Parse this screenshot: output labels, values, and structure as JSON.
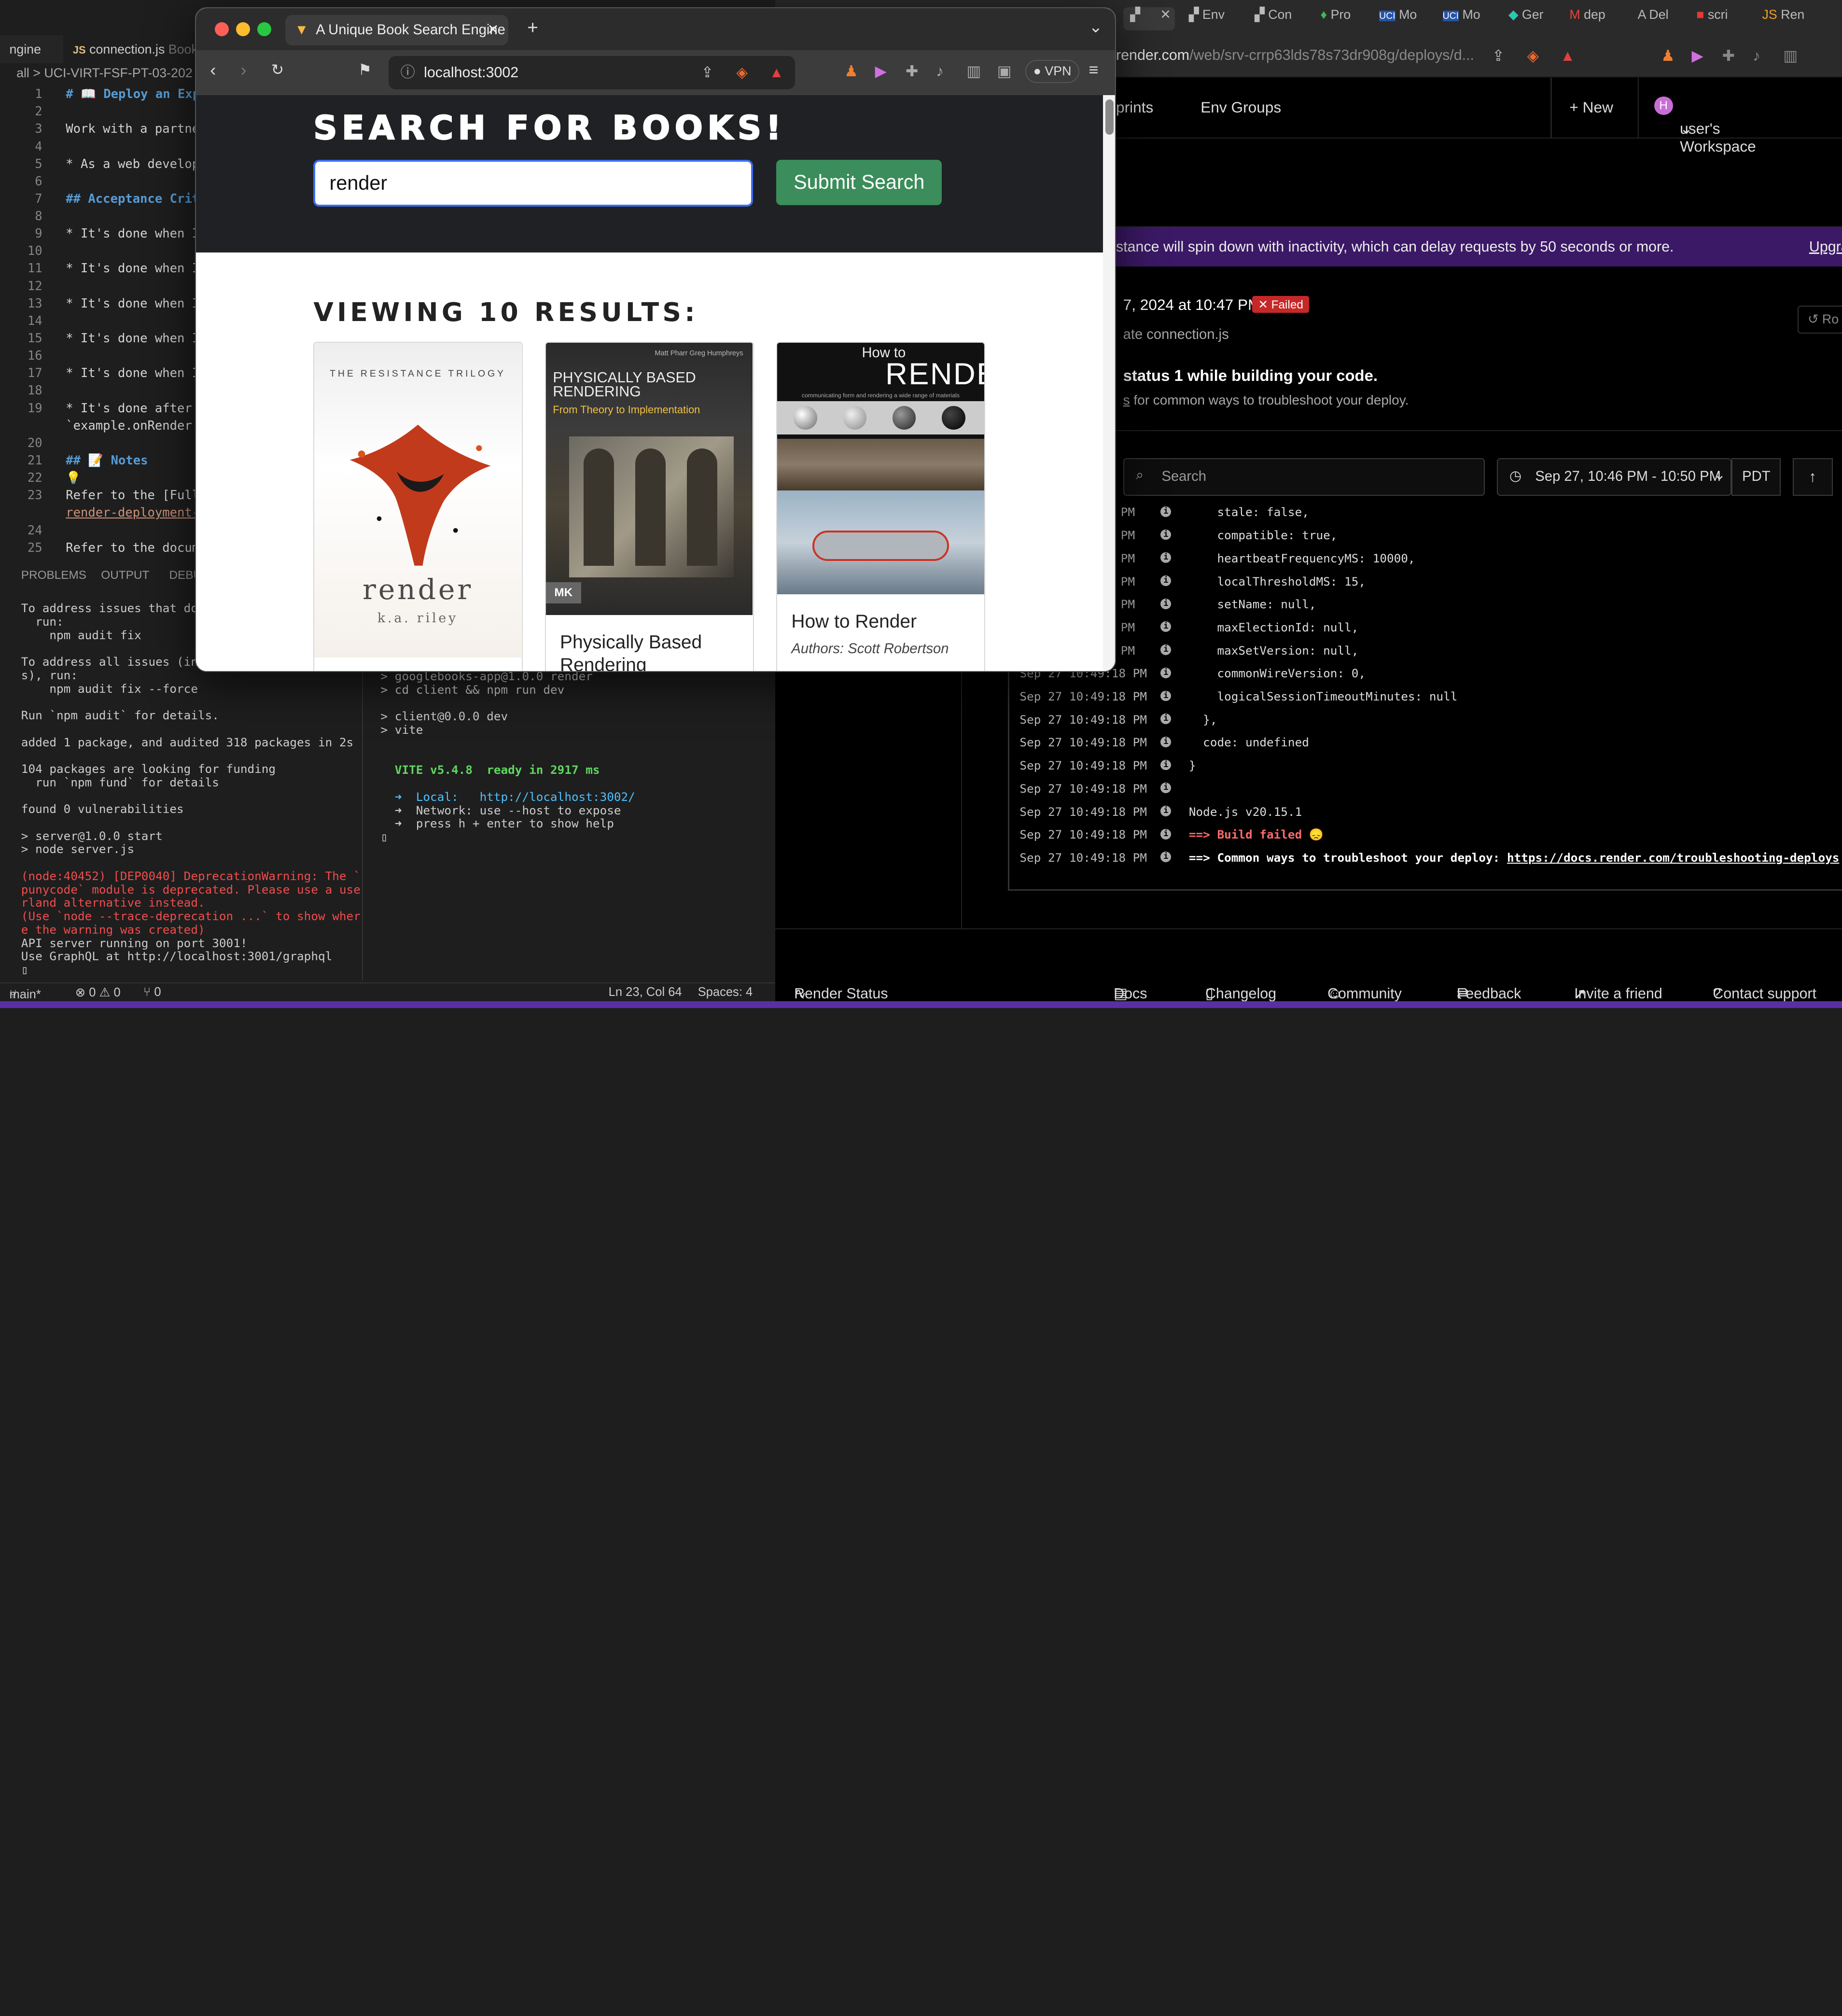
{
  "vscode": {
    "tab_left": "ngine",
    "tab_file": "connection.js",
    "tab_file_suffix": "Book",
    "breadcrumb": "all > UCI-VIRT-FSF-PT-03-202",
    "lines": [
      {
        "n": "1",
        "t": "# 📖 Deploy an Expr",
        "c": "h"
      },
      {
        "n": "2",
        "t": "",
        "c": ""
      },
      {
        "n": "3",
        "t": "Work with a partner",
        "c": ""
      },
      {
        "n": "4",
        "t": "",
        "c": ""
      },
      {
        "n": "5",
        "t": "* As a web develope",
        "c": ""
      },
      {
        "n": "6",
        "t": "",
        "c": ""
      },
      {
        "n": "7",
        "t": "## Acceptance Crite",
        "c": "h"
      },
      {
        "n": "8",
        "t": "",
        "c": ""
      },
      {
        "n": "9",
        "t": "* It's done when I",
        "c": ""
      },
      {
        "n": "10",
        "t": "",
        "c": ""
      },
      {
        "n": "11",
        "t": "* It's done when I",
        "c": ""
      },
      {
        "n": "12",
        "t": "",
        "c": ""
      },
      {
        "n": "13",
        "t": "* It's done when I",
        "c": ""
      },
      {
        "n": "14",
        "t": "",
        "c": ""
      },
      {
        "n": "15",
        "t": "* It's done when I",
        "c": ""
      },
      {
        "n": "16",
        "t": "",
        "c": ""
      },
      {
        "n": "17",
        "t": "* It's done when I",
        "c": ""
      },
      {
        "n": "18",
        "t": "",
        "c": ""
      },
      {
        "n": "19",
        "t": "* It's done after I",
        "c": ""
      },
      {
        "n": "",
        "t": "`example.onRender.c",
        "c": ""
      },
      {
        "n": "20",
        "t": "",
        "c": ""
      },
      {
        "n": "21",
        "t": "## 📝 Notes",
        "c": "h"
      },
      {
        "n": "22",
        "t": "💡",
        "c": ""
      },
      {
        "n": "23",
        "t": "Refer to the [Full-",
        "c": ""
      },
      {
        "n": "",
        "t": "render-deployment-c",
        "c": "u"
      },
      {
        "n": "24",
        "t": "",
        "c": ""
      },
      {
        "n": "25",
        "t": "Refer to the docume",
        "c": ""
      }
    ],
    "panel_tabs": [
      "PROBLEMS",
      "OUTPUT",
      "DEBU"
    ],
    "terminal_left": [
      {
        "t": "To address issues that do",
        "c": ""
      },
      {
        "t": "  run:",
        "c": ""
      },
      {
        "t": "    npm audit fix",
        "c": ""
      },
      {
        "t": "",
        "c": ""
      },
      {
        "t": "To address all issues (inc",
        "c": ""
      },
      {
        "t": "s), run:",
        "c": ""
      },
      {
        "t": "    npm audit fix --force",
        "c": ""
      },
      {
        "t": "",
        "c": ""
      },
      {
        "t": "Run `npm audit` for details.",
        "c": ""
      },
      {
        "t": "",
        "c": ""
      },
      {
        "t": "added 1 package, and audited 318 packages in 2s",
        "c": ""
      },
      {
        "t": "",
        "c": ""
      },
      {
        "t": "104 packages are looking for funding",
        "c": ""
      },
      {
        "t": "  run `npm fund` for details",
        "c": ""
      },
      {
        "t": "",
        "c": ""
      },
      {
        "t": "found 0 vulnerabilities",
        "c": ""
      },
      {
        "t": "",
        "c": ""
      },
      {
        "t": "> server@1.0.0 start",
        "c": ""
      },
      {
        "t": "> node server.js",
        "c": ""
      },
      {
        "t": "",
        "c": ""
      },
      {
        "t": "(node:40452) [DEP0040] DeprecationWarning: The `",
        "c": "err"
      },
      {
        "t": "punycode` module is deprecated. Please use a use",
        "c": "err"
      },
      {
        "t": "rland alternative instead.",
        "c": "err"
      },
      {
        "t": "(Use `node --trace-deprecation ...` to show wher",
        "c": "err"
      },
      {
        "t": "e the warning was created)",
        "c": "err"
      },
      {
        "t": "API server running on port 3001!",
        "c": ""
      },
      {
        "t": "Use GraphQL at http://localhost:3001/graphql",
        "c": ""
      },
      {
        "t": "▯",
        "c": ""
      }
    ],
    "terminal_right": [
      {
        "t": "> googlebooks-app@1.0.0 render",
        "c": ""
      },
      {
        "t": "> cd client && npm run dev",
        "c": ""
      },
      {
        "t": "",
        "c": ""
      },
      {
        "t": "> client@0.0.0 dev",
        "c": ""
      },
      {
        "t": "> vite",
        "c": ""
      },
      {
        "t": "",
        "c": ""
      },
      {
        "t": "",
        "c": ""
      },
      {
        "t": "  VITE v5.4.8  ready in 2917 ms",
        "c": "vite"
      },
      {
        "t": "",
        "c": ""
      },
      {
        "t": "  ➜  Local:   http://localhost:3002/",
        "c": "url"
      },
      {
        "t": "  ➜  Network: use --host to expose",
        "c": ""
      },
      {
        "t": "  ➜  press h + enter to show help",
        "c": ""
      },
      {
        "t": "▯",
        "c": ""
      }
    ],
    "status": {
      "branch": "main*",
      "errors": "⊗ 0 ⚠ 0",
      "ports": "⑂ 0",
      "position": "Ln 23, Col 64",
      "spaces": "Spaces: 4"
    }
  },
  "render": {
    "tabs": [
      "",
      "Env",
      "Con",
      "Pro",
      "Mo",
      "Mo",
      "Ger",
      "dep",
      "Del",
      "scri",
      "Ren"
    ],
    "url_host": "render.com",
    "url_path": "/web/srv-crrp63lds78s73dr908g/deploys/d...",
    "nav": {
      "blueprints": "prints",
      "env_groups": "Env Groups",
      "new": "+ New",
      "workspace": "user's Workspace",
      "workspace_initial": "H"
    },
    "banner": "stance will spin down with inactivity, which can delay requests by 50 seconds or more.",
    "banner_link": "Upgra",
    "deploy_date": "7, 2024 at 10:47 PM",
    "deploy_status": "✕ Failed",
    "deploy_commit": "ate connection.js",
    "rollback": "↺ Ro",
    "error_title": "status 1 while building your code.",
    "error_link": "s",
    "error_sub": " for common ways to troubleshoot your deploy.",
    "search_placeholder": "Search",
    "range": "Sep 27, 10:46 PM - 10:50 PM",
    "tz": "PDT",
    "up": "↑",
    "logs": [
      {
        "ts": "8 PM",
        "msg": "    stale: false,",
        "c": ""
      },
      {
        "ts": "8 PM",
        "msg": "    compatible: true,",
        "c": ""
      },
      {
        "ts": "8 PM",
        "msg": "    heartbeatFrequencyMS: 10000,",
        "c": ""
      },
      {
        "ts": "8 PM",
        "msg": "    localThresholdMS: 15,",
        "c": ""
      },
      {
        "ts": "8 PM",
        "msg": "    setName: null,",
        "c": ""
      },
      {
        "ts": "8 PM",
        "msg": "    maxElectionId: null,",
        "c": ""
      },
      {
        "ts": "8 PM",
        "msg": "    maxSetVersion: null,",
        "c": ""
      },
      {
        "ts": "Sep 27 10:49:18 PM",
        "msg": "    commonWireVersion: 0,",
        "c": ""
      },
      {
        "ts": "Sep 27 10:49:18 PM",
        "msg": "    logicalSessionTimeoutMinutes: null",
        "c": ""
      },
      {
        "ts": "Sep 27 10:49:18 PM",
        "msg": "  },",
        "c": ""
      },
      {
        "ts": "Sep 27 10:49:18 PM",
        "msg": "  code: undefined",
        "c": ""
      },
      {
        "ts": "Sep 27 10:49:18 PM",
        "msg": "}",
        "c": ""
      },
      {
        "ts": "Sep 27 10:49:18 PM",
        "msg": "",
        "c": ""
      },
      {
        "ts": "Sep 27 10:49:18 PM",
        "msg": "Node.js v20.15.1",
        "c": ""
      },
      {
        "ts": "Sep 27 10:49:18 PM",
        "msg": "==> Build failed 😞",
        "c": "bad"
      },
      {
        "ts": "Sep 27 10:49:18 PM",
        "msg": "==> Common ways to troubleshoot your deploy: ",
        "link": "https://docs.render.com/troubleshooting-deploys",
        "c": "bold"
      }
    ],
    "footer": {
      "status": "Render Status",
      "docs": "Docs",
      "changelog": "Changelog",
      "community": "Community",
      "feedback": "Feedback",
      "invite": "Invite a friend",
      "contact": "Contact support"
    }
  },
  "books_window": {
    "tab_title": "A Unique Book Search Engine",
    "url": "localhost:3002",
    "vpn": "VPN",
    "heading": "SEARCH FOR BOOKS!",
    "search_value": "render",
    "submit_label": "Submit Search",
    "results_heading": "VIEWING 10 RESULTS:",
    "books": [
      {
        "title": "",
        "authors": "",
        "cover_top": "THE RESISTANCE TRILOGY",
        "cover_main": "render",
        "cover_sub": "k.a. riley"
      },
      {
        "title": "Physically Based Rendering",
        "authors": "",
        "cover_top": "Matt Pharr  Greg Humphreys",
        "cover_main": "PHYSICALLY BASED RENDERING",
        "cover_sub": "From Theory to Implementation",
        "cover_badge": "MK"
      },
      {
        "title": "How to Render",
        "authors": "Authors: Scott Robertson",
        "cover_top": "How to",
        "cover_main": "RENDER",
        "cover_sub": "communicating form and rendering a wide range of materials"
      }
    ]
  },
  "colors": {
    "accent_green": "#3b8d5b",
    "input_focus": "#3b6df2",
    "failed_red": "#c62828",
    "banner_purple": "#3b1966"
  }
}
